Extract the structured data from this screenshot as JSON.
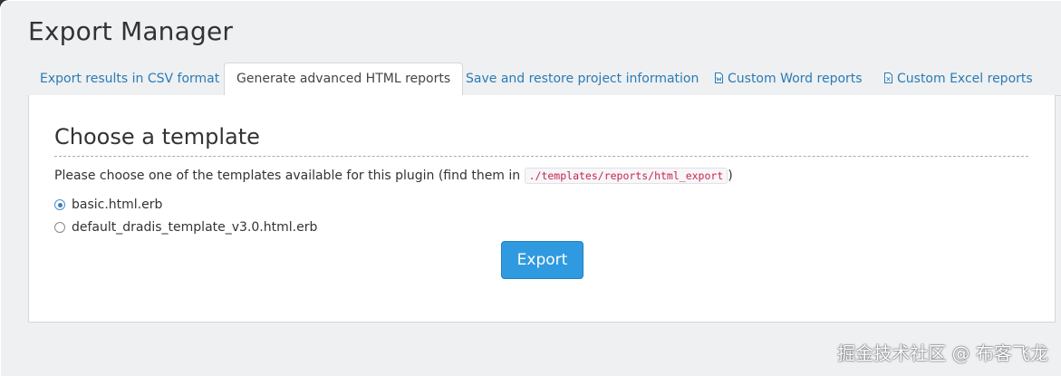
{
  "page": {
    "title": "Export Manager"
  },
  "tabs": [
    {
      "label": "Export results in CSV format",
      "icon": null,
      "active": false
    },
    {
      "label": "Generate advanced HTML reports",
      "icon": null,
      "active": true
    },
    {
      "label": "Save and restore project information",
      "icon": null,
      "active": false
    },
    {
      "label": "Custom Word reports",
      "icon": "word-doc-icon",
      "active": false
    },
    {
      "label": "Custom Excel reports",
      "icon": "excel-doc-icon",
      "active": false
    }
  ],
  "panel": {
    "title": "Choose a template",
    "intro_text": "Please choose one of the templates available for this plugin (find them in ",
    "intro_path": "./templates/reports/html_export",
    "intro_close": ")",
    "templates": [
      {
        "label": "basic.html.erb",
        "selected": true
      },
      {
        "label": "default_dradis_template_v3.0.html.erb",
        "selected": false
      }
    ],
    "export_button": "Export"
  },
  "watermark": "掘金技术社区 @ 布客飞龙",
  "colors": {
    "link": "#2a7bb5",
    "button": "#2f9ae0",
    "code": "#c7254e"
  }
}
